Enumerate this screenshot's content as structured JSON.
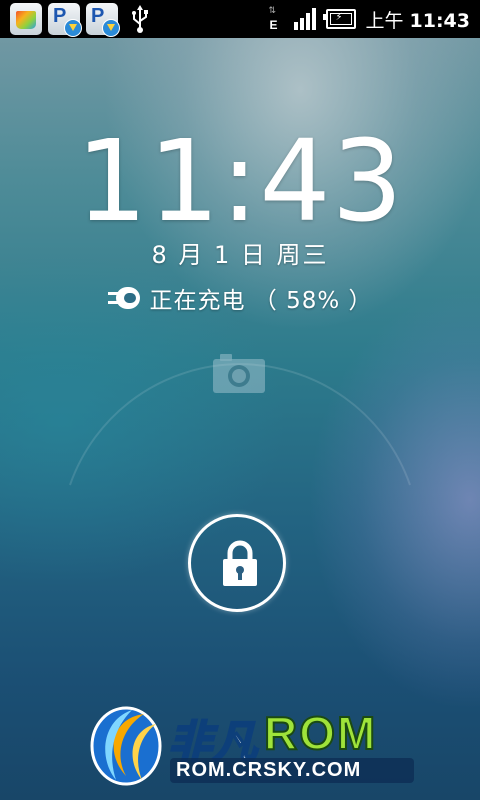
{
  "status_bar": {
    "notification_icons": [
      "market-icon",
      "app-update-icon",
      "app-update-icon",
      "usb-icon"
    ],
    "network_type": "E",
    "signal_bars": 4,
    "ampm": "上午",
    "time": "11:43"
  },
  "lockscreen": {
    "clock": "11:43",
    "date": "8 月 1 日 周三",
    "charging_status": "正在充电 （ 58% ）",
    "battery_percent": 58
  },
  "watermark": {
    "brand_cn": "非凡",
    "brand_rom": "ROM",
    "url": "ROM.CRSKY.COM"
  },
  "colors": {
    "status_bar_bg": "#000000",
    "text": "#ffffff",
    "wallpaper_top": "#7a9ba6",
    "wallpaper_bottom": "#184668",
    "watermark_green": "#9fe33a"
  }
}
